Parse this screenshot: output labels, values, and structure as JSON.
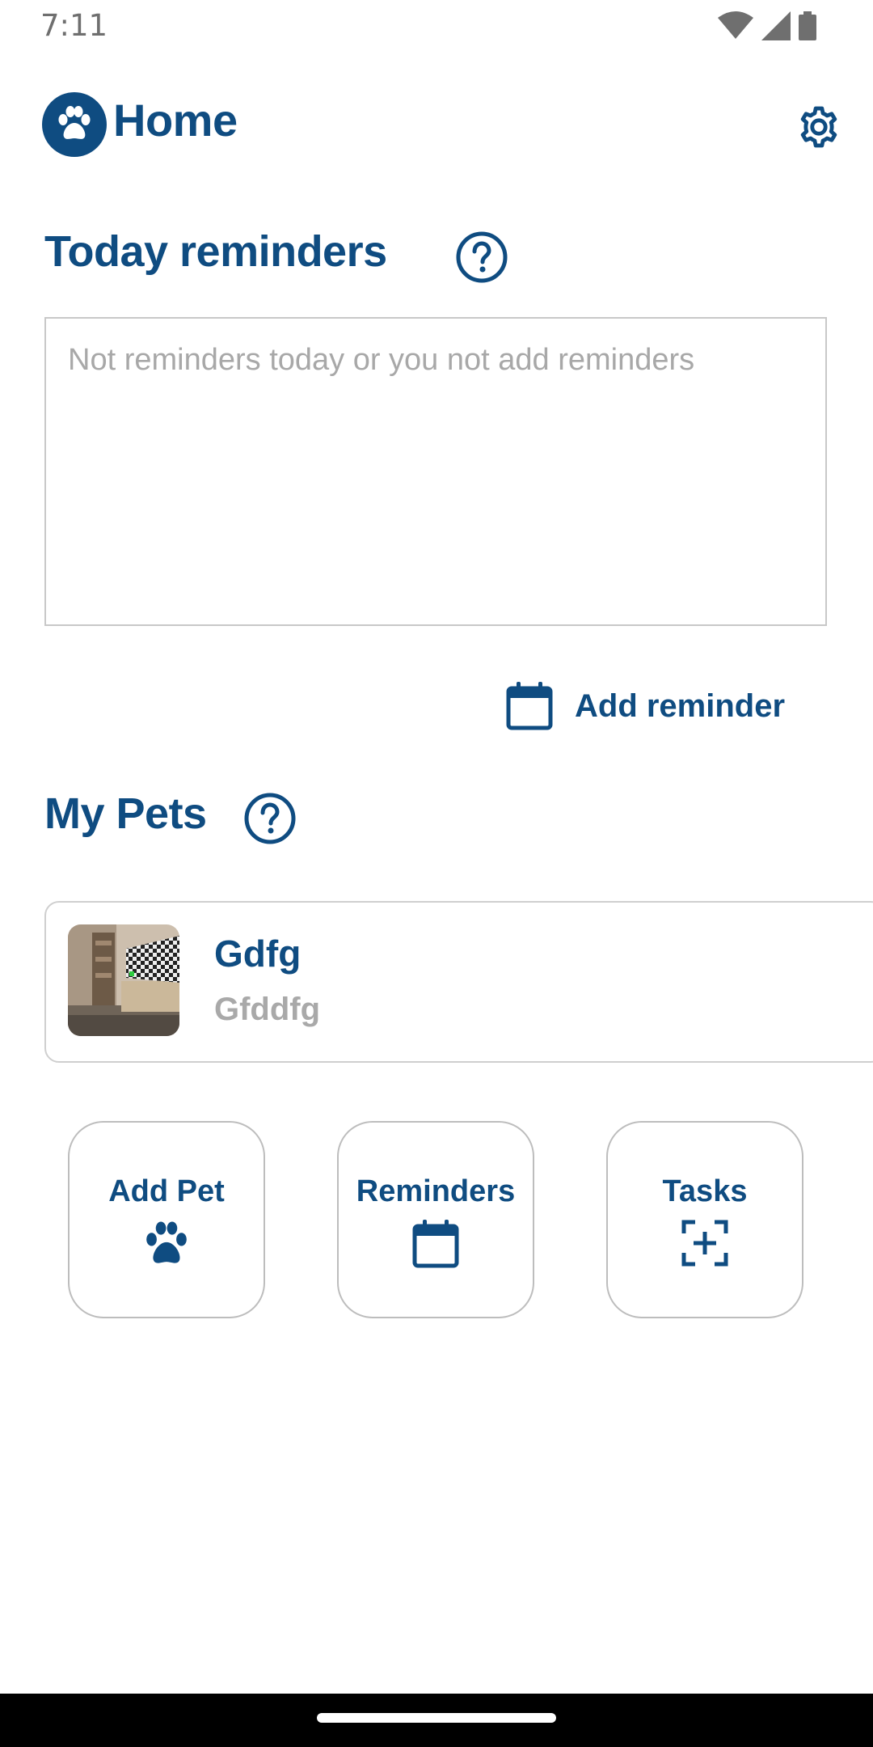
{
  "status_bar": {
    "time": "7:11",
    "icons": [
      "wifi-icon",
      "signal-icon",
      "battery-icon"
    ]
  },
  "header": {
    "title": "Home",
    "logo_icon": "paw-icon",
    "settings_icon": "gear-icon"
  },
  "reminders": {
    "title": "Today reminders",
    "help_icon": "help-circle-icon",
    "empty_text": "Not reminders today or you not add reminders",
    "add_label": "Add reminder",
    "add_icon": "calendar-icon"
  },
  "pets": {
    "title": "My Pets",
    "help_icon": "help-circle-icon",
    "items": [
      {
        "name": "Gdfg",
        "breed": "Gfddfg"
      }
    ]
  },
  "actions": [
    {
      "label": "Add Pet",
      "icon": "paw-icon"
    },
    {
      "label": "Reminders",
      "icon": "calendar-icon"
    },
    {
      "label": "Tasks",
      "icon": "add-task-icon"
    }
  ],
  "colors": {
    "brand": "#0f4c81",
    "muted_text": "#a8a8a8",
    "border": "#c8c8c8"
  }
}
